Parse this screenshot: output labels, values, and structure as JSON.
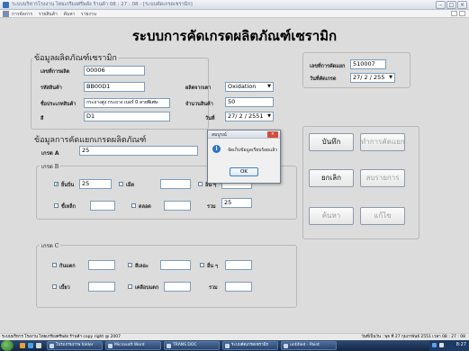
{
  "window": {
    "title": "ระบบบริหารโรงงาน ไทยเกรียงศรีพลัง ร้านค้า 08 : 27 : 08 - [ระบบคัดเกรดเชรามิก]"
  },
  "menu": {
    "items": [
      "การจัดการ",
      "รายสินค้า",
      "ค้นหา",
      "รายงาน"
    ]
  },
  "heading": "ระบบการคัดเกรดผลิตภัณฑ์เซรามิก",
  "product_info": {
    "title": "ข้อมูลผลิตภัณฑ์เซรามิก",
    "fields": {
      "product_no": {
        "label": "เลขที่การผลิต",
        "value": "00006"
      },
      "product_code": {
        "label": "รหัสสินค้า",
        "value": "BB00D1"
      },
      "product_name": {
        "label": "ชื่อประเภทสินค้า",
        "value": "กระถางสูง กระถาง เบอร์ 0 ลายพิเศษ"
      },
      "color": {
        "label": "สี",
        "value": "D1"
      },
      "glaze": {
        "label": "ผลิตจากเตา",
        "value": "Oxidation"
      },
      "quantity": {
        "label": "จำนวนสินค้า",
        "value": "50"
      },
      "date": {
        "label": "วันที่",
        "value": "27/ 2 / 2551"
      }
    }
  },
  "grading_record": {
    "no_label": "เลขที่การคัดแยก",
    "no_value": "510007",
    "date_label": "วันที่คัดเกรด",
    "date_value": "27/ 2 / 255"
  },
  "grading": {
    "title": "ข้อมูลการคัดแยกเกรดผลิตภัณฑ์",
    "grade_a_label": "เกรด A",
    "grade_a_value": "25",
    "grade_b": {
      "title": "เกรด B",
      "items": [
        {
          "label": "ยิ้นบิ่น",
          "checked": true,
          "value": "25"
        },
        {
          "label": "เม็ด",
          "checked": false,
          "value": ""
        },
        {
          "label": "อื่น ๆ",
          "checked": false,
          "value": ""
        },
        {
          "label": "ขี้เหล็ก",
          "checked": false,
          "value": ""
        },
        {
          "label": "ตลอด",
          "checked": false,
          "value": ""
        }
      ],
      "total_label": "รวม",
      "total_value": "25"
    },
    "grade_c": {
      "title": "เกรด C",
      "items": [
        {
          "label": "ก้นแตก",
          "checked": false,
          "value": ""
        },
        {
          "label": "สีเลอะ",
          "checked": false,
          "value": ""
        },
        {
          "label": "อื่น ๆ",
          "checked": false,
          "value": ""
        },
        {
          "label": "เบี้ยว",
          "checked": false,
          "value": ""
        },
        {
          "label": "เคลือบแตก",
          "checked": false,
          "value": ""
        }
      ],
      "total_label": "รวม",
      "total_value": ""
    }
  },
  "buttons": {
    "save": "บันทึก",
    "sort_list": "ทำการคัดแยก",
    "cancel": "ยกเลิก",
    "report": "ลบรายการ",
    "search": "ค้นหา",
    "edit": "แก้ไข"
  },
  "dialog": {
    "title": "สมบูรณ์",
    "message": "จัดเก็บข้อมูลเรียบร้อยแล้ว",
    "ok": "OK"
  },
  "statusbar": {
    "left": "ระบบบริหาร โรงงาน ไทยเกรียงศรีพลัง ร้านค้า copy right @ 2007",
    "right": "วันที่เป็นวัน : พุธ ที่ 27 กุมภาพันธ์ 2551   เวลา   08 : 27 : 08"
  },
  "taskbar": {
    "tasks": [
      "โปรแกรมภาพ folder",
      "Microsoft Word",
      "TRANS DOC",
      "ระบบคัดเกรดเซรามิก",
      "untitled - Paint"
    ],
    "clock": "8:27"
  },
  "colors": {
    "background": "#dcdcdc",
    "field_border": "#7f9db9",
    "taskbar": "#1f3a63",
    "dialog_icon": "#2e6fd0",
    "close_button": "#d44a3b"
  }
}
